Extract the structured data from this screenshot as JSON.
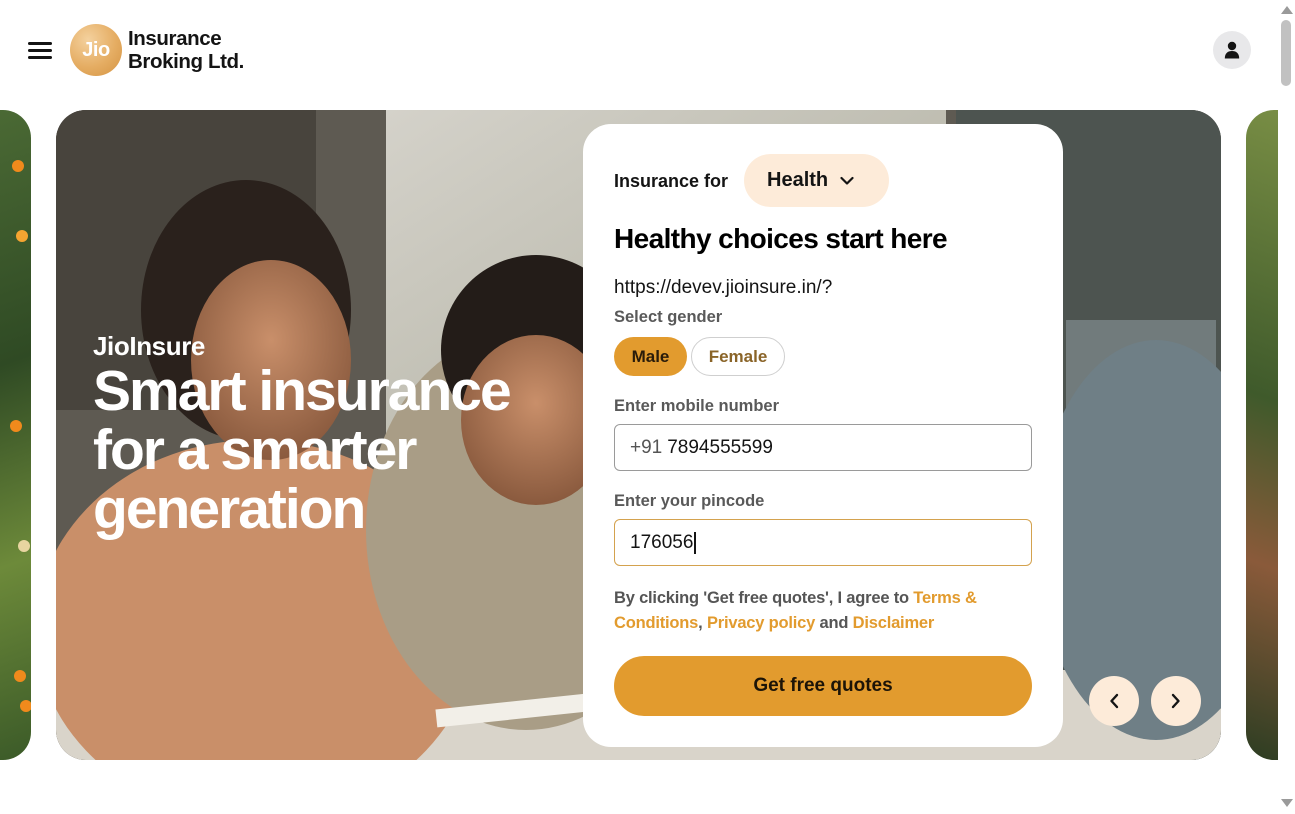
{
  "header": {
    "menu_icon": "hamburger-menu-icon",
    "logo_mark": "Jio",
    "logo_line1": "Insurance",
    "logo_line2": "Broking Ltd.",
    "profile_icon": "user-icon"
  },
  "hero": {
    "brand": "JioInsure",
    "title_line1": "Smart insurance",
    "title_line2": "for a smarter",
    "title_line3": "generation"
  },
  "form": {
    "insurance_for_label": "Insurance for",
    "insurance_type": "Health",
    "heading": "Healthy choices start here",
    "url_text": "https://devev.jioinsure.in/?",
    "gender_label": "Select gender",
    "gender_options": [
      "Male",
      "Female"
    ],
    "gender_selected": "Male",
    "mobile_label": "Enter mobile number",
    "mobile_prefix": "+91",
    "mobile_value": "7894555599",
    "pincode_label": "Enter your pincode",
    "pincode_value": "176056",
    "consent_text": "By clicking 'Get free quotes', I agree to",
    "consent_terms": "Terms & Conditions",
    "consent_comma": ",",
    "consent_privacy": "Privacy policy",
    "consent_and": "and",
    "consent_disclaimer": "Disclaimer",
    "submit_label": "Get free quotes"
  },
  "carousel": {
    "prev_icon": "chevron-left-icon",
    "next_icon": "chevron-right-icon"
  },
  "colors": {
    "accent": "#e29b2e",
    "accent_light": "#fdebd9",
    "text": "#141414",
    "muted": "#595959"
  }
}
